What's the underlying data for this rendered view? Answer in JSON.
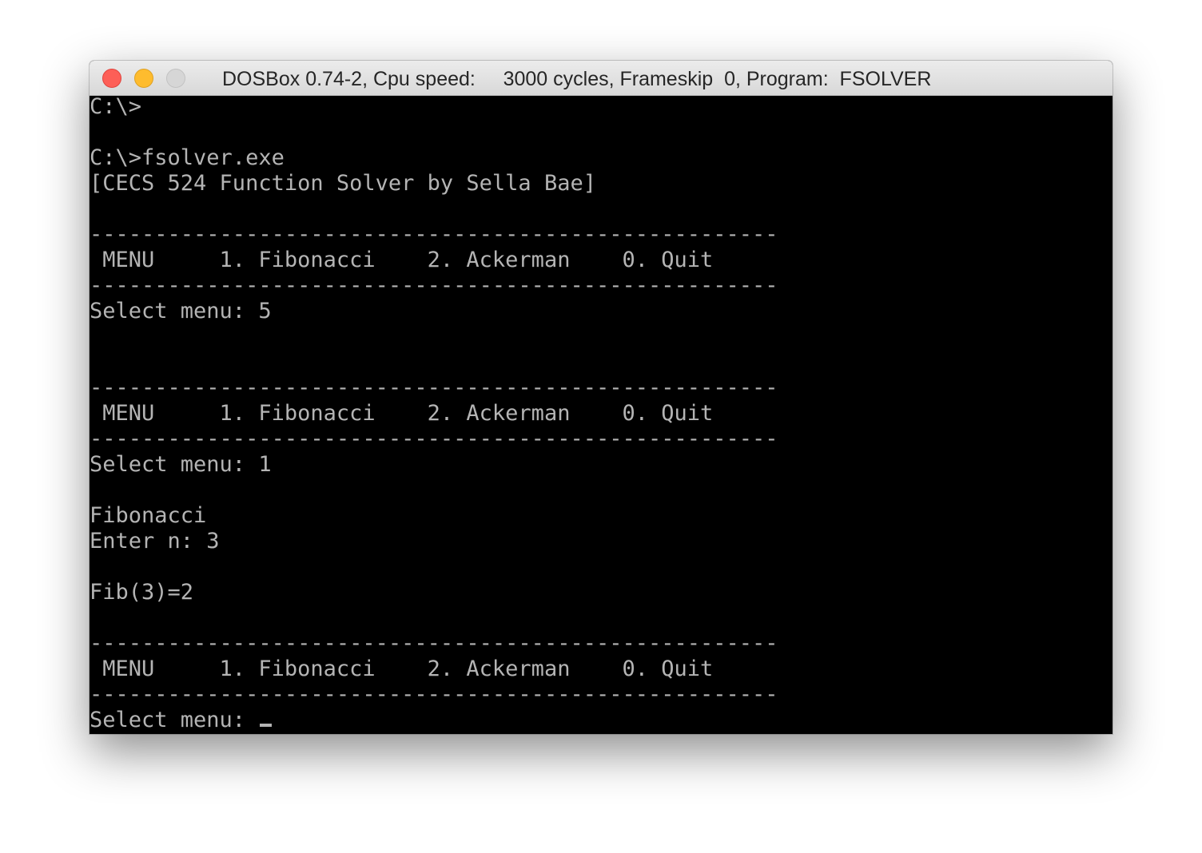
{
  "window": {
    "title": "DOSBox 0.74-2, Cpu speed:     3000 cycles, Frameskip  0, Program:  FSOLVER",
    "buttons": [
      "close",
      "minimize",
      "zoom"
    ]
  },
  "terminal": {
    "lines": [
      "C:\\>",
      "",
      "C:\\>fsolver.exe",
      "[CECS 524 Function Solver by Sella Bae]",
      "",
      "-----------------------------------------------------",
      " MENU     1. Fibonacci    2. Ackerman    0. Quit",
      "-----------------------------------------------------",
      "Select menu: 5",
      "",
      "",
      "-----------------------------------------------------",
      " MENU     1. Fibonacci    2. Ackerman    0. Quit",
      "-----------------------------------------------------",
      "Select menu: 1",
      "",
      "Fibonacci",
      "Enter n: 3",
      "",
      "Fib(3)=2",
      "",
      "-----------------------------------------------------",
      " MENU     1. Fibonacci    2. Ackerman    0. Quit",
      "-----------------------------------------------------"
    ],
    "prompt": "Select menu: "
  },
  "colors": {
    "terminal_bg": "#000000",
    "terminal_fg": "#b4b4b4",
    "close": "#fd5f57",
    "minimize": "#febc2e",
    "zoom": "#d6d6d6"
  }
}
